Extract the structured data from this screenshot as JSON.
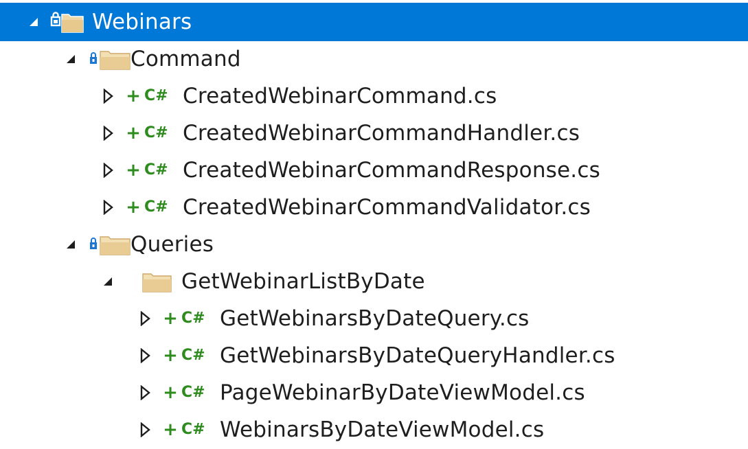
{
  "tree": {
    "root": {
      "label": "Webinars",
      "expander": "collapse-arrow-icon",
      "icon": "locked-folder-icon"
    },
    "command_folder": {
      "label": "Command",
      "expander": "collapse-arrow-icon",
      "icon": "locked-folder-icon"
    },
    "command_files": [
      {
        "label": "CreatedWebinarCommand.cs",
        "pending": "+",
        "type": "C#"
      },
      {
        "label": "CreatedWebinarCommandHandler.cs",
        "pending": "+",
        "type": "C#"
      },
      {
        "label": "CreatedWebinarCommandResponse.cs",
        "pending": "+",
        "type": "C#"
      },
      {
        "label": "CreatedWebinarCommandValidator.cs",
        "pending": "+",
        "type": "C#"
      }
    ],
    "queries_folder": {
      "label": "Queries",
      "expander": "collapse-arrow-icon",
      "icon": "locked-folder-icon"
    },
    "date_folder": {
      "label": "GetWebinarListByDate",
      "expander": "collapse-arrow-icon",
      "icon": "folder-icon"
    },
    "date_files": [
      {
        "label": "GetWebinarsByDateQuery.cs",
        "pending": "+",
        "type": "C#"
      },
      {
        "label": "GetWebinarsByDateQueryHandler.cs",
        "pending": "+",
        "type": "C#"
      },
      {
        "label": "PageWebinarByDateViewModel.cs",
        "pending": "+",
        "type": "C#"
      },
      {
        "label": "WebinarsByDateViewModel.cs",
        "pending": "+",
        "type": "C#"
      }
    ]
  },
  "colors": {
    "selection": "#0078d7",
    "folder": "#dcb67a",
    "lock": "#1e78d2",
    "csharp": "#2e8b1e",
    "text": "#1e1e1e"
  }
}
